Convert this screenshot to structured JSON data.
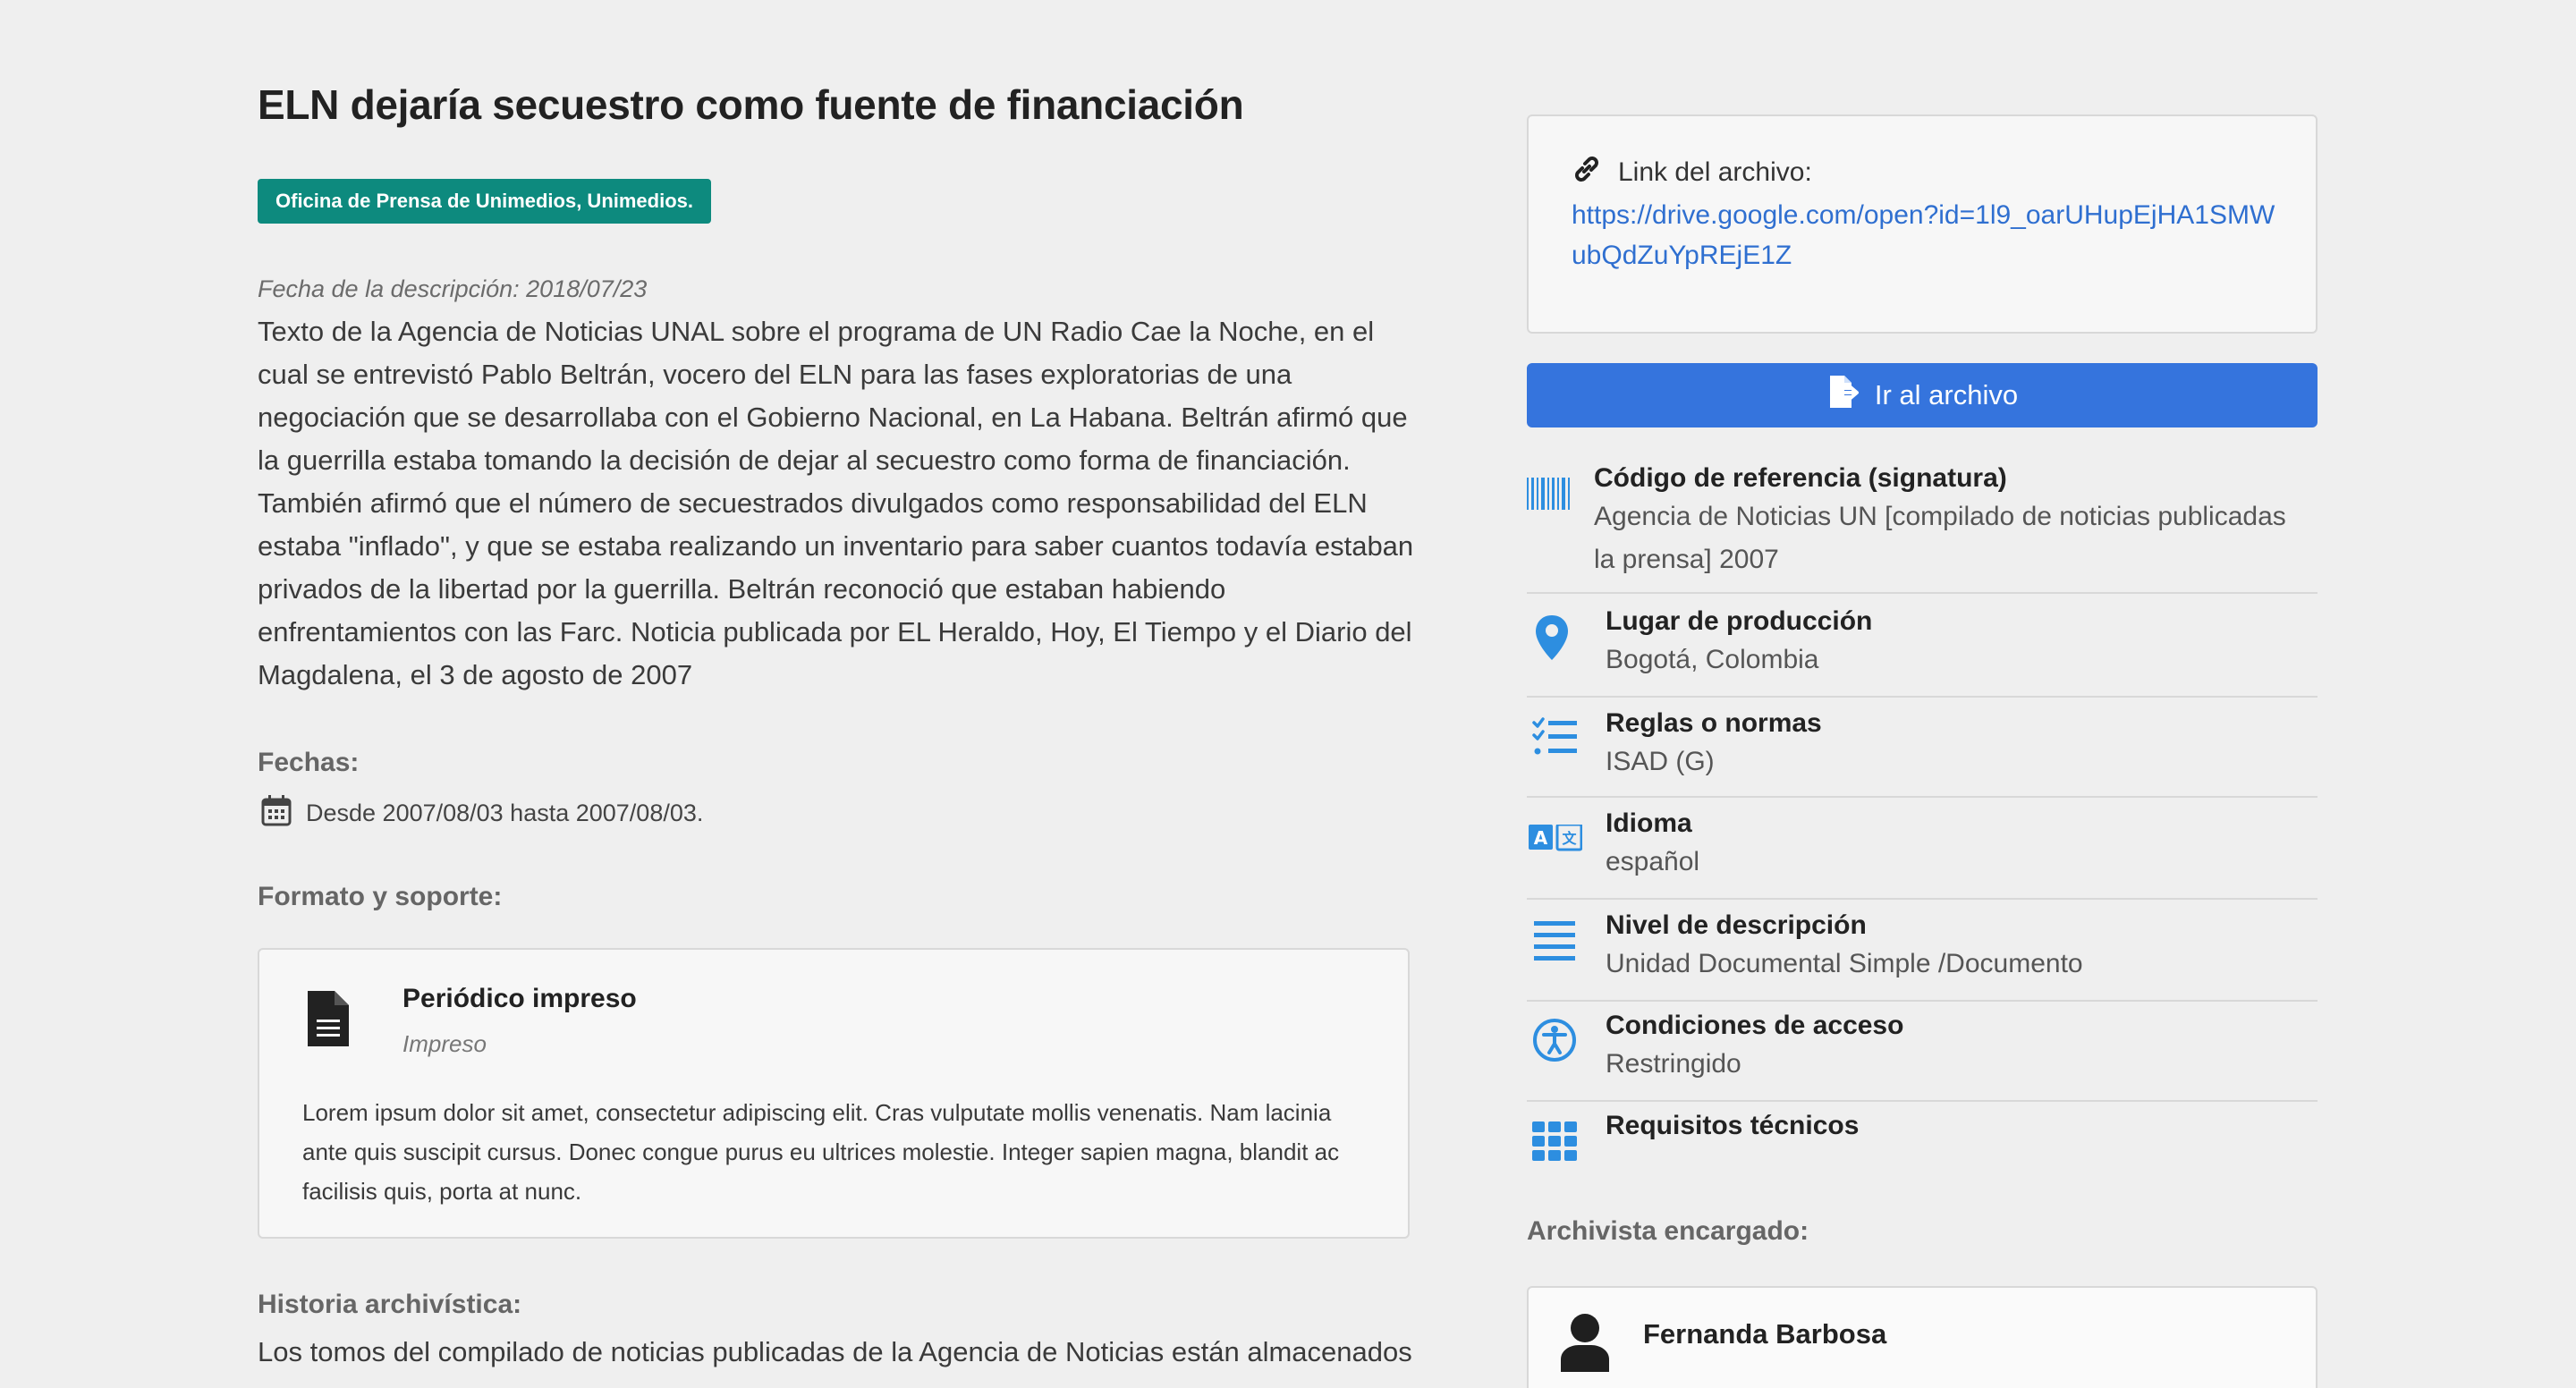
{
  "record": {
    "title": "ELN dejaría secuestro como fuente de financiación",
    "source_badge": "Oficina de Prensa de Unimedios, Unimedios.",
    "description_date": "Fecha de la descripción: 2018/07/23",
    "description": "Texto de la Agencia de Noticias UNAL sobre el programa de UN Radio Cae la Noche, en el cual se entrevistó Pablo Beltrán, vocero del ELN para las fases exploratorias de una negociación que se desarrollaba con el Gobierno Nacional, en La Habana. Beltrán afirmó que la guerrilla estaba tomando la decisión de dejar al secuestro como forma de financiación. También afirmó que el número de secuestrados divulgados como responsabilidad del ELN estaba \"inflado\", y que se estaba realizando un inventario para saber cuantos todavía estaban privados de la libertad por la guerrilla. Beltrán reconoció que estaban habiendo enfrentamientos con las Farc. Noticia publicada por EL Heraldo, Hoy, El Tiempo y el Diario del Magdalena, el 3 de agosto de 2007"
  },
  "dates": {
    "label": "Fechas:",
    "range": "Desde 2007/08/03 hasta 2007/08/03."
  },
  "format": {
    "label": "Formato y soporte:",
    "title": "Periódico impreso",
    "subtitle": "Impreso",
    "body": "Lorem ipsum dolor sit amet, consectetur adipiscing elit. Cras vulputate mollis venenatis. Nam lacinia ante quis suscipit cursus. Donec congue purus eu ultrices molestie. Integer sapien magna, blandit ac facilisis quis, porta at nunc."
  },
  "history": {
    "label": "Historia archivística:",
    "text": "Los tomos del compilado de noticias publicadas de la Agencia de Noticias están almacenados"
  },
  "file_link": {
    "label": "Link del archivo:",
    "url": "https://drive.google.com/open?id=1l9_oarUHupEjHA1SMWubQdZuYpREjE1Z"
  },
  "go_button": {
    "label": "Ir al archivo"
  },
  "metadata": [
    {
      "icon": "barcode-icon",
      "label": "Código de referencia (signatura)",
      "value": "Agencia de Noticias UN [compilado de noticias publicadas la prensa] 2007"
    },
    {
      "icon": "location-pin-icon",
      "label": "Lugar de producción",
      "value": "Bogotá, Colombia"
    },
    {
      "icon": "checklist-icon",
      "label": "Reglas o normas",
      "value": "ISAD (G)"
    },
    {
      "icon": "translate-icon",
      "label": "Idioma",
      "value": "español"
    },
    {
      "icon": "lines-icon",
      "label": "Nivel de descripción",
      "value": "Unidad Documental Simple /Documento"
    },
    {
      "icon": "accessibility-icon",
      "label": "Condiciones de acceso",
      "value": "Restringido"
    },
    {
      "icon": "grid-icon",
      "label": "Requisitos técnicos",
      "value": ""
    }
  ],
  "archivist": {
    "label": "Archivista encargado:",
    "name": "Fernanda Barbosa"
  },
  "colors": {
    "background": "#efefef",
    "badge": "#0d8a7e",
    "button": "#3574dd",
    "link": "#2f6fd0",
    "icon_blue": "#2d8ee0"
  }
}
